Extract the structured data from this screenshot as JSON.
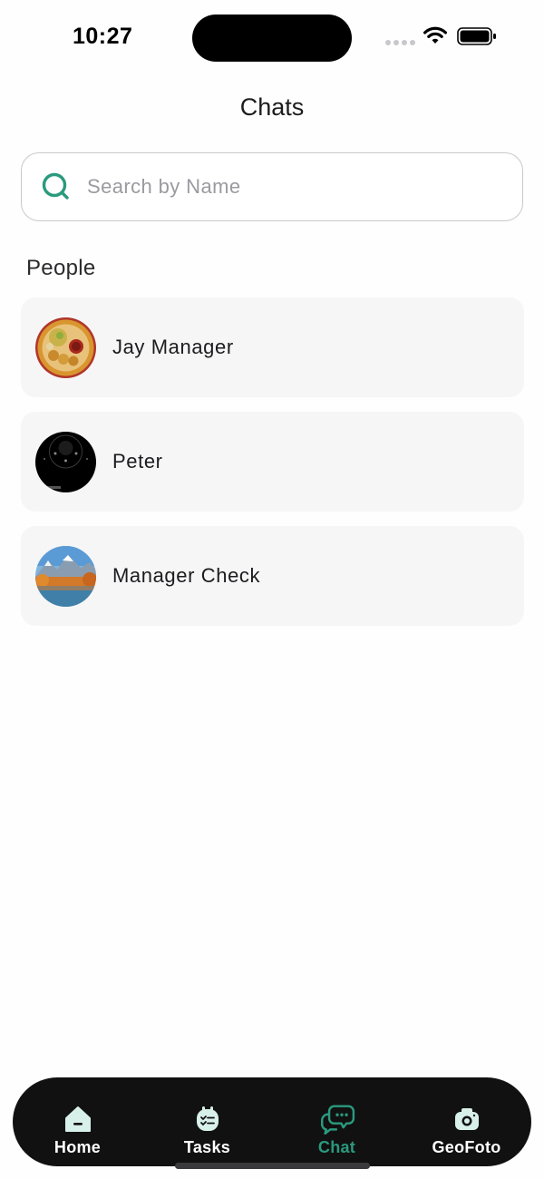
{
  "status_bar": {
    "time": "10:27"
  },
  "header": {
    "title": "Chats"
  },
  "search": {
    "placeholder": "Search by Name",
    "value": ""
  },
  "people": {
    "section_label": "People",
    "items": [
      {
        "name": "Jay Manager",
        "avatar": "food-platter-photo"
      },
      {
        "name": "Peter",
        "avatar": "dark-watchface-photo"
      },
      {
        "name": "Manager Check",
        "avatar": "mountain-lake-photo"
      }
    ]
  },
  "tab_bar": {
    "active": "Chat",
    "tabs": [
      {
        "label": "Home",
        "icon": "home-icon"
      },
      {
        "label": "Tasks",
        "icon": "tasks-icon"
      },
      {
        "label": "Chat",
        "icon": "chat-icon"
      },
      {
        "label": "GeoFoto",
        "icon": "camera-icon"
      }
    ]
  },
  "colors": {
    "accent": "#2a9a7e",
    "tab_bar_bg": "#111111",
    "card_bg": "#f6f6f7"
  }
}
